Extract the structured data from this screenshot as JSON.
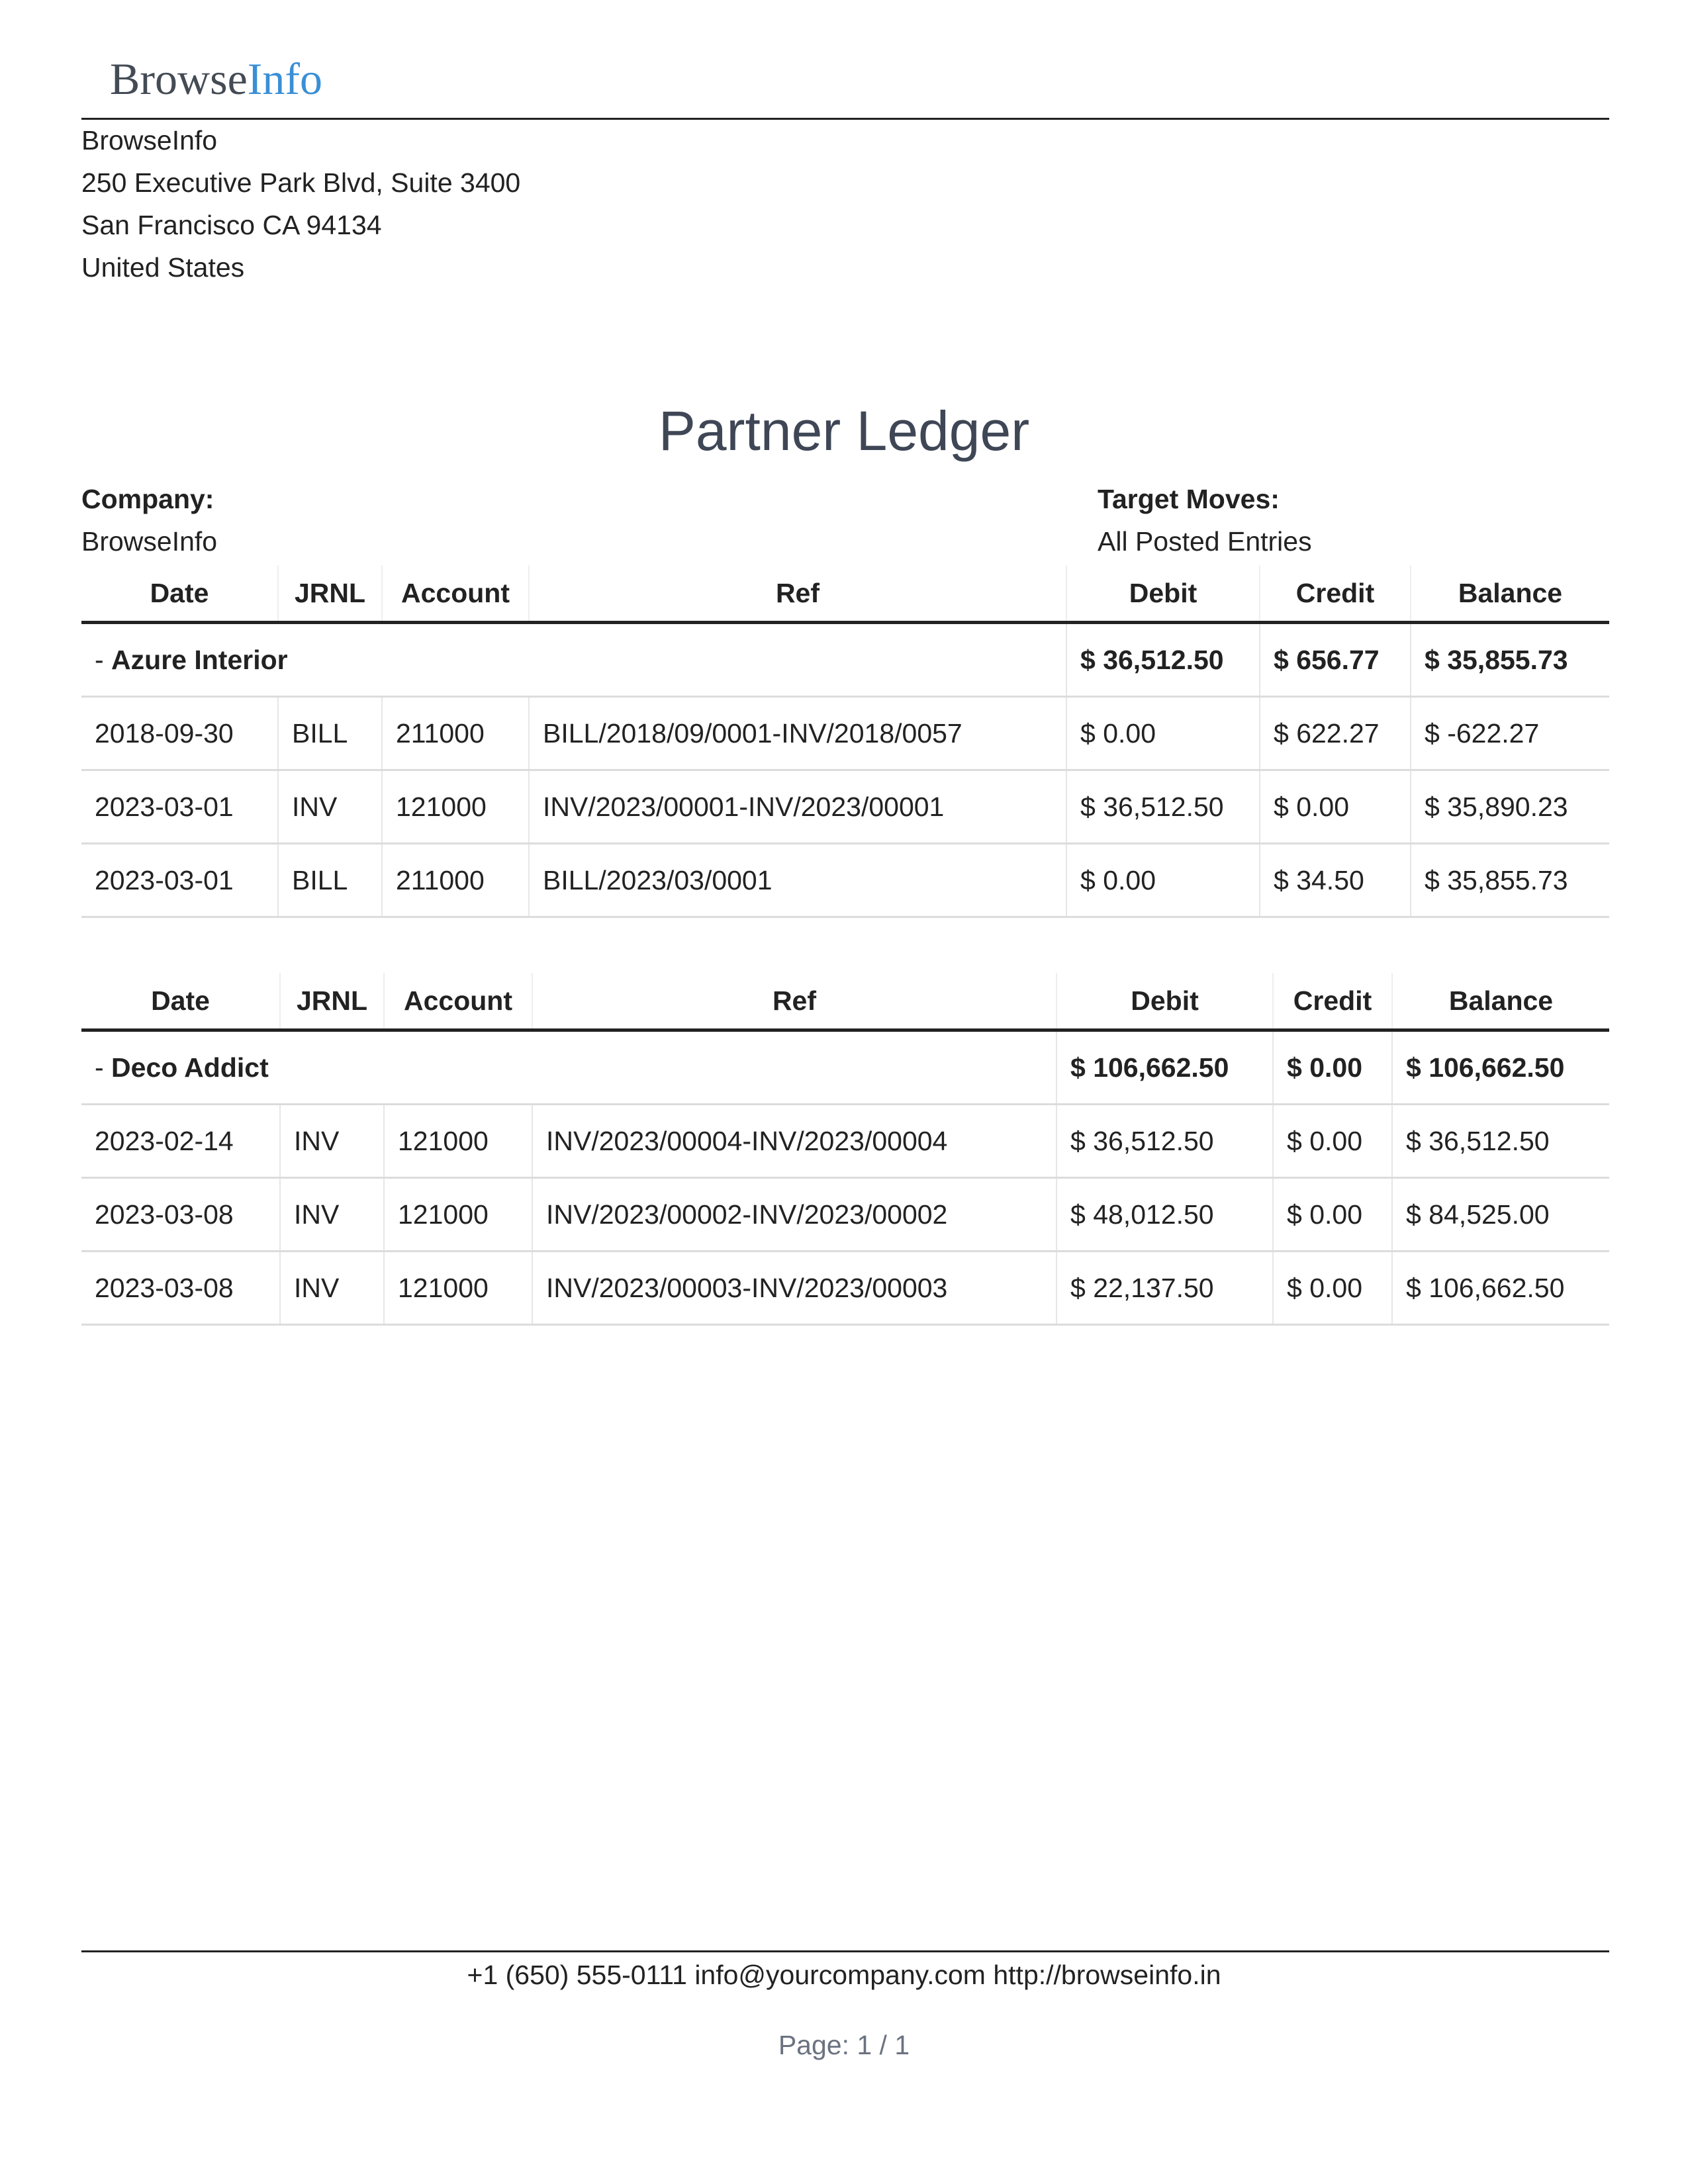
{
  "header": {
    "logo_part1": "Browse",
    "logo_part2": "Info",
    "logo_accent_color": "#3a8fd6"
  },
  "company_address": {
    "name": "BrowseInfo",
    "line1": "250 Executive Park Blvd, Suite 3400",
    "line2": "San Francisco CA 94134",
    "country": "United States"
  },
  "report": {
    "title": "Partner Ledger",
    "company_label": "Company:",
    "company_value": "BrowseInfo",
    "target_moves_label": "Target Moves:",
    "target_moves_value": "All Posted Entries"
  },
  "columns": [
    "Date",
    "JRNL",
    "Account",
    "Ref",
    "Debit",
    "Credit",
    "Balance"
  ],
  "partners": [
    {
      "prefix": "- ",
      "name": "Azure Interior",
      "debit": "$ 36,512.50",
      "credit": "$ 656.77",
      "balance": "$ 35,855.73",
      "lines": [
        {
          "date": "2018-09-30",
          "jrnl": "BILL",
          "account": "211000",
          "ref": "BILL/2018/09/0001-INV/2018/0057",
          "debit": "$ 0.00",
          "credit": "$ 622.27",
          "balance": "$ -622.27"
        },
        {
          "date": "2023-03-01",
          "jrnl": "INV",
          "account": "121000",
          "ref": "INV/2023/00001-INV/2023/00001",
          "debit": "$ 36,512.50",
          "credit": "$ 0.00",
          "balance": "$ 35,890.23"
        },
        {
          "date": "2023-03-01",
          "jrnl": "BILL",
          "account": "211000",
          "ref": "BILL/2023/03/0001",
          "debit": "$ 0.00",
          "credit": "$ 34.50",
          "balance": "$ 35,855.73"
        }
      ]
    },
    {
      "prefix": "- ",
      "name": "Deco Addict",
      "debit": "$ 106,662.50",
      "credit": "$ 0.00",
      "balance": "$ 106,662.50",
      "lines": [
        {
          "date": "2023-02-14",
          "jrnl": "INV",
          "account": "121000",
          "ref": "INV/2023/00004-INV/2023/00004",
          "debit": "$ 36,512.50",
          "credit": "$ 0.00",
          "balance": "$ 36,512.50"
        },
        {
          "date": "2023-03-08",
          "jrnl": "INV",
          "account": "121000",
          "ref": "INV/2023/00002-INV/2023/00002",
          "debit": "$ 48,012.50",
          "credit": "$ 0.00",
          "balance": "$ 84,525.00"
        },
        {
          "date": "2023-03-08",
          "jrnl": "INV",
          "account": "121000",
          "ref": "INV/2023/00003-INV/2023/00003",
          "debit": "$ 22,137.50",
          "credit": "$ 0.00",
          "balance": "$ 106,662.50"
        }
      ]
    }
  ],
  "footer": {
    "contact": "+1 (650) 555-0111 info@yourcompany.com http://browseinfo.in",
    "page": "Page: 1 / 1"
  }
}
